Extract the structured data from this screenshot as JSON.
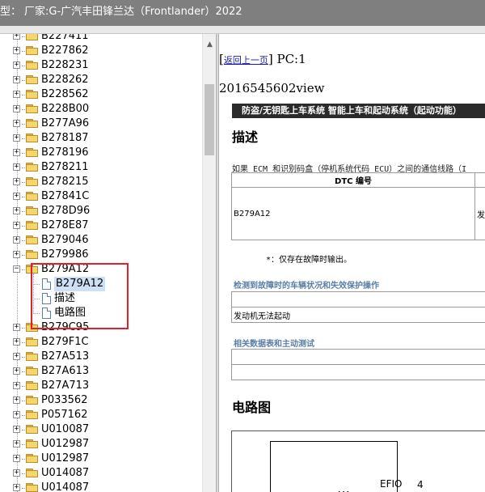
{
  "title_bar": {
    "prefix": "型：",
    "manufacturer": "厂家:G-广汽丰田锋兰达（Frontlander）2022"
  },
  "tree": {
    "items_before": [
      "B227411",
      "B227862",
      "B228231",
      "B228262",
      "B228562",
      "B228B00",
      "B277A96",
      "B278187",
      "B278196",
      "B278211",
      "B278215",
      "B27841C",
      "B278D96",
      "B278E87",
      "B279046",
      "B279986"
    ],
    "expanded_node": "B279A12",
    "children": [
      "B279A12",
      "描述",
      "电路图"
    ],
    "items_after": [
      "B279C95",
      "B279F1C",
      "B27A513",
      "B27A613",
      "B27A713",
      "P033562",
      "P057162",
      "U010087",
      "U012987",
      "U012987",
      "U014087",
      "U014087"
    ]
  },
  "content": {
    "back_link": "返回上一页",
    "page_counter": "PC:1",
    "view_id": "2016545602view",
    "banner": "防盗/无钥匙上车系统  智能上车和起动系统（起动功能）",
    "desc_heading": "描述",
    "desc_text": "如果 ECM 和识别码盒（停机系统代码 ECU）之间的通信线路（I",
    "dtc_header": "DTC 编号",
    "dtc_code": "B279A12",
    "dtc_cut": "发",
    "note": "*：仅存在故障时输出。",
    "cond_heading": "检测到故障时的车辆状况和失效保护操作",
    "cond_header_cut": "检",
    "cond_row": "发动机无法起动",
    "data_heading": "相关数据表和主动测试",
    "circuit_heading": "电路图",
    "diagram_label": "EFIO",
    "diagram_pin": "4"
  }
}
